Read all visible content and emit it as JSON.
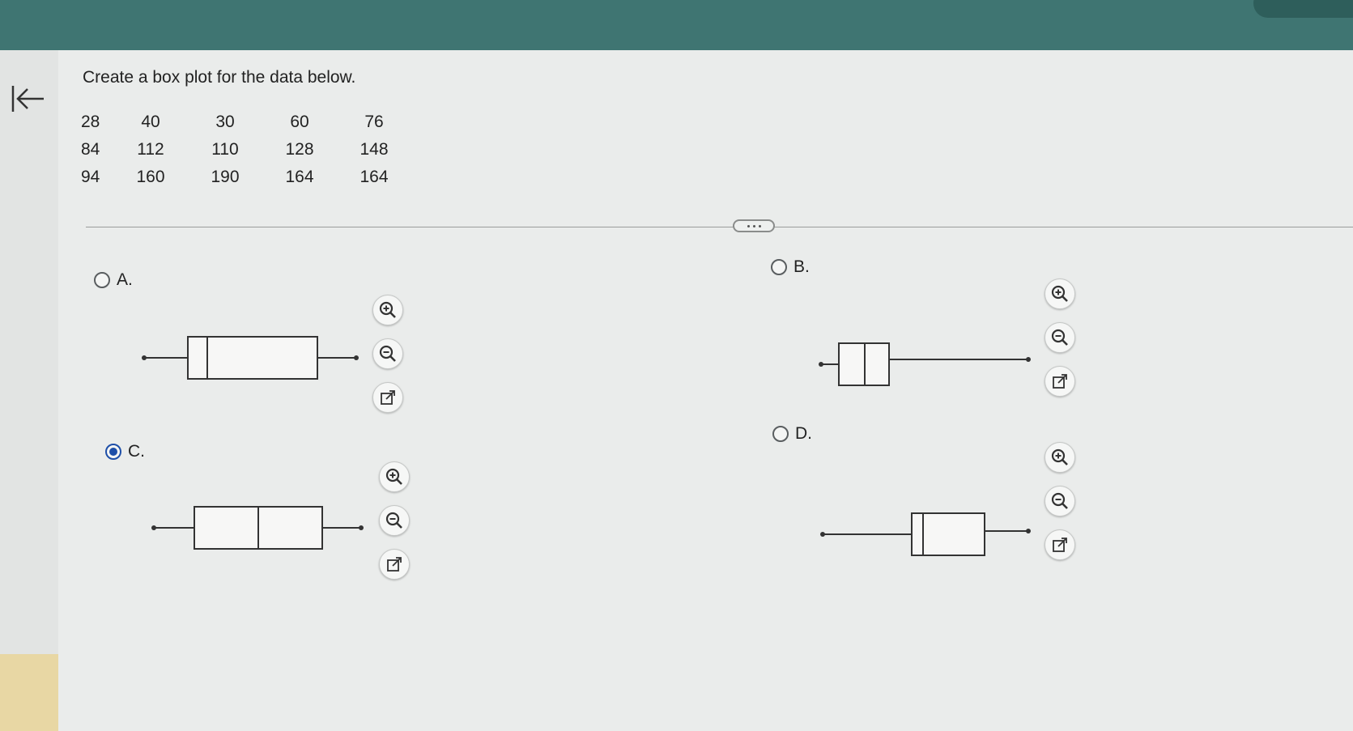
{
  "question": "Create a box plot for the data below.",
  "data_rows": [
    [
      "28",
      "40",
      "30",
      "60",
      "76"
    ],
    [
      "84",
      "112",
      "110",
      "128",
      "148"
    ],
    [
      "94",
      "160",
      "190",
      "164",
      "164"
    ]
  ],
  "options": [
    {
      "letter": "A.",
      "selected": false
    },
    {
      "letter": "B.",
      "selected": false
    },
    {
      "letter": "C.",
      "selected": true
    },
    {
      "letter": "D.",
      "selected": false
    }
  ],
  "tools": [
    "zoom-in-icon",
    "zoom-out-icon",
    "open-external-icon"
  ],
  "colors": {
    "topbar": "#3f7572",
    "radio_selected": "#1e4fa8",
    "plot_stroke": "#333333"
  }
}
